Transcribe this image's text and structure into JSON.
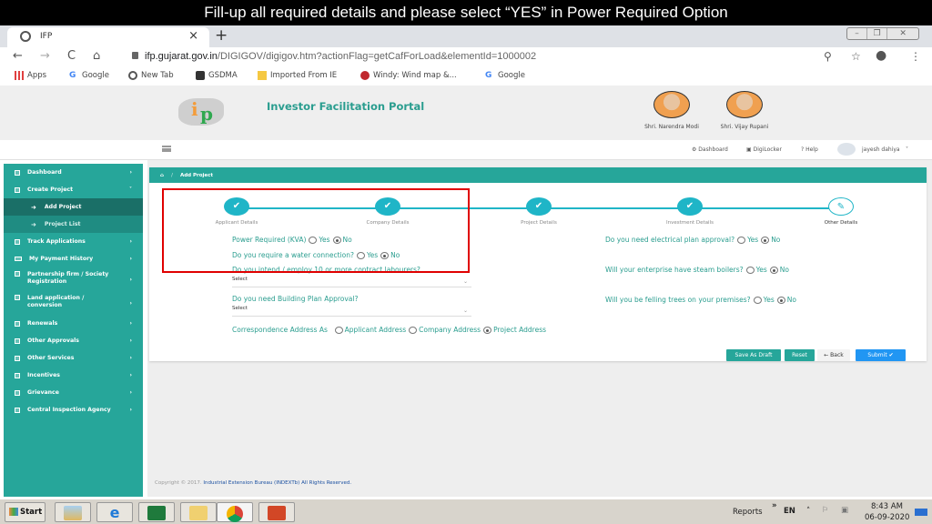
{
  "caption": "Fill-up all required details and please select “YES” in Power Required Option",
  "browser": {
    "tab_title": "IFP",
    "tab_close": "×",
    "new_tab": "+",
    "url_domain": "ifp.gujarat.gov.in",
    "url_path": "/DIGIGOV/digigov.htm?actionFlag=getCafForLoad&elementId=1000002",
    "nav": {
      "back": "←",
      "forward": "→",
      "reload": "C",
      "home": "⌂"
    },
    "bookmarks": [
      {
        "label": "Apps",
        "icon": "apps-grid-icon",
        "color": "#e04040"
      },
      {
        "label": "Google",
        "icon": "google-icon",
        "color": "#4285f4"
      },
      {
        "label": "New Tab",
        "icon": "globe-icon",
        "color": "#555555"
      },
      {
        "label": "GSDMA",
        "icon": "gsdma-icon",
        "color": "#333333"
      },
      {
        "label": "Imported From IE",
        "icon": "folder-icon",
        "color": "#f5c842"
      },
      {
        "label": "Windy: Wind map &...",
        "icon": "windy-icon",
        "color": "#c0272d"
      },
      {
        "label": "Google",
        "icon": "google-icon",
        "color": "#4285f4"
      }
    ]
  },
  "header": {
    "portal_title": "Investor Facilitation Portal",
    "logo_i": "i",
    "logo_p": "p",
    "leaders": [
      "Shri. Narendra Modi",
      "Shri. Vijay Rupani"
    ]
  },
  "topnav": {
    "dashboard": "⚙ Dashboard",
    "digilocker": "▣ DigiLocker",
    "help": "? Help",
    "user": "jayesh dahiya",
    "user_caret": "˅"
  },
  "sidebar": {
    "items": [
      {
        "label": "Dashboard",
        "chevron": "›"
      },
      {
        "label": "Create Project",
        "chevron": "˅"
      },
      {
        "label": "Track Applications",
        "chevron": "›"
      },
      {
        "label": "My Payment History",
        "chevron": "›"
      },
      {
        "label": "Partnership firm / Society Registration",
        "chevron": "›"
      },
      {
        "label": "Land application / conversion",
        "chevron": "›"
      },
      {
        "label": "Renewals",
        "chevron": "›"
      },
      {
        "label": "Other Approvals",
        "chevron": "›"
      },
      {
        "label": "Other Services",
        "chevron": "›"
      },
      {
        "label": "Incentives",
        "chevron": "›"
      },
      {
        "label": "Grievance",
        "chevron": "›"
      },
      {
        "label": "Central Inspection Agency",
        "chevron": "›"
      }
    ],
    "sub_items": [
      {
        "label": "Add Project",
        "active": true
      },
      {
        "label": "Project List",
        "active": false
      }
    ],
    "color": "#26a69a"
  },
  "breadcrumb": {
    "home_icon": "⌂",
    "separator": "/",
    "current": "Add Project"
  },
  "steps": [
    {
      "label": "Applicant Details",
      "status": "done"
    },
    {
      "label": "Company Details",
      "status": "done"
    },
    {
      "label": "Project Details",
      "status": "done"
    },
    {
      "label": "Investment Details",
      "status": "done"
    },
    {
      "label": "Other Details",
      "status": "current"
    }
  ],
  "form": {
    "yes": "Yes",
    "no": "No",
    "power_required": {
      "label": "Power Required (KVA)",
      "value": "No"
    },
    "water_connection": {
      "label": "Do you require a water connection?",
      "value": "No"
    },
    "contract_labourers": {
      "label": "Do you intend / employ 10 or more contract labourers?",
      "value": "Select"
    },
    "building_plan": {
      "label": "Do you need Building Plan Approval?",
      "value": "Select"
    },
    "electrical_plan": {
      "label": "Do you need electrical plan approval?",
      "value": "No"
    },
    "steam_boilers": {
      "label": "Will your enterprise have steam boilers?",
      "value": "No"
    },
    "felling_trees": {
      "label": "Will you be felling trees on your premises?",
      "value": "No"
    },
    "correspondence": {
      "label": "Correspondence Address As",
      "options": [
        "Applicant Address",
        "Company Address",
        "Project Address"
      ],
      "value": "Project Address"
    }
  },
  "buttons": {
    "save_draft": "Save As Draft",
    "reset": "Reset",
    "back": "← Back",
    "submit": "Submit ✔"
  },
  "footer": {
    "prefix": "Copyright © 2017.",
    "org": "Industrial Extension Bureau (INDEXTb) All Rights Reserved."
  },
  "taskbar": {
    "start": "Start",
    "reports": "Reports",
    "overflow": "»",
    "lang": "EN",
    "time": "8:43 AM",
    "date": "06-09-2020"
  }
}
